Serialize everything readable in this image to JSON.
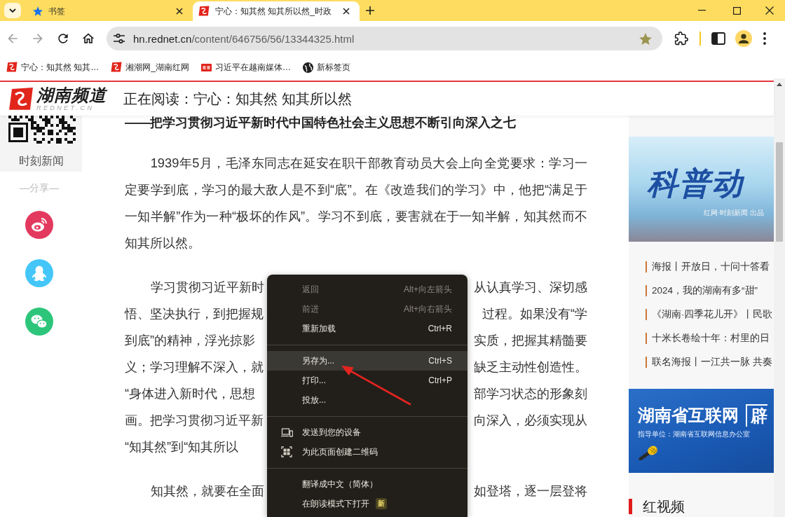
{
  "tab_strip": {
    "tabs": [
      {
        "kind": "bookmarks",
        "title": "书签",
        "selected": false
      },
      {
        "kind": "site",
        "title": "宁心：知其然 知其所以然_时政",
        "selected": true
      }
    ]
  },
  "toolbar": {
    "nav_buttons": [
      {
        "kind": "back",
        "disabled": true
      },
      {
        "kind": "forward",
        "disabled": true
      },
      {
        "kind": "reload",
        "disabled": false
      },
      {
        "kind": "home",
        "disabled": false
      }
    ],
    "url_host": "hn.rednet.cn",
    "url_path": "/content/646756/56/13344325.html",
    "bookmarked": true
  },
  "bookmarks_bar": [
    {
      "kind": "site",
      "label": "宁心：知其然 知其…"
    },
    {
      "kind": "site",
      "label": "湘潮网_湖南红网"
    },
    {
      "kind": "news",
      "label": "习近平在越南媒体…"
    },
    {
      "kind": "globe",
      "label": "新标签页"
    }
  ],
  "header": {
    "logo_title": "湖南频道",
    "logo_subtitle": "REDNET.CN",
    "reading": "正在阅读：宁心：知其然 知其所以然"
  },
  "left_rail": {
    "qr_caption": "时刻新闻",
    "share_label": "—分享—",
    "share": [
      {
        "kind": "weibo",
        "color": "#e4395e"
      },
      {
        "kind": "qq",
        "color": "#44c6f8"
      },
      {
        "kind": "wechat",
        "color": "#2dc57a"
      }
    ]
  },
  "article": {
    "subtitle": "——把学习贯彻习近平新时代中国特色社会主义思想不断引向深入之七",
    "paragraphs": [
      {
        "kind": "full",
        "text": "1939年5月，毛泽东同志在延安在职干部教育动员大会上向全党要求：学习一定要学到底，学习的最大敌人是不到“底”。在《改造我们的学习》中，他把“满足于一知半解”作为一种“极坏的作风”。学习不到底，要害就在于一知半解，知其然而不知其所以然。"
      },
      {
        "kind": "covered",
        "lines": [
          {
            "left": "学习贯彻习近平新时",
            "right": "从认真学习、深切感"
          },
          {
            "left": "悟、坚决执行，到把握规",
            "right": "过程。如果没有“学"
          },
          {
            "left": "到底”的精神，浮光掠影",
            "right": "实质，把握其精髓要"
          },
          {
            "left": "义；学习理解不深入，就",
            "right": "缺乏主动性创造性。"
          },
          {
            "left": "“身体进入新时代，思想",
            "right": "部学习状态的形象刻"
          },
          {
            "left": "画。把学习贯彻习近平新",
            "right": "向深入，必须实现从"
          },
          {
            "left": "“知其然”到“知其所以"
          }
        ]
      },
      {
        "kind": "covered",
        "lines": [
          {
            "left": "知其然，就要在全面",
            "right": "如登塔，逐一层登将"
          }
        ]
      }
    ]
  },
  "sidebar": {
    "banner_top": {
      "title": "科普动",
      "credit": "红网·时刻新闻 出品"
    },
    "links": [
      "海报丨开放日，十问十答看",
      "2024，我的湖南有多“甜”",
      "《湖南·四季花儿开》丨民歌",
      "十米长卷绘十年：村里的日",
      "联名海报丨一江共一脉 共奏"
    ],
    "banner_bottom": {
      "title": "湖南省互联网",
      "tag": "辟",
      "credit": "指导单位：湖南省互联网信息办公室"
    },
    "section_title": "红视频"
  },
  "context_menu": {
    "items": [
      {
        "kind": "item",
        "label": "返回",
        "shortcut": "Alt+向左箭头",
        "disabled": true,
        "selected": false
      },
      {
        "kind": "item",
        "label": "前进",
        "shortcut": "Alt+向右箭头",
        "disabled": true,
        "selected": false
      },
      {
        "kind": "item",
        "label": "重新加载",
        "shortcut": "Ctrl+R",
        "disabled": false,
        "selected": false
      },
      {
        "kind": "separator"
      },
      {
        "kind": "item",
        "label": "另存为...",
        "shortcut": "Ctrl+S",
        "disabled": false,
        "selected": true
      },
      {
        "kind": "item",
        "label": "打印...",
        "shortcut": "Ctrl+P",
        "disabled": false,
        "selected": false
      },
      {
        "kind": "item",
        "label": "投放...",
        "disabled": false,
        "selected": false
      },
      {
        "kind": "separator"
      },
      {
        "kind": "send",
        "label": "发送到您的设备",
        "disabled": false,
        "selected": false
      },
      {
        "kind": "qr",
        "label": "为此页面创建二维码",
        "disabled": false,
        "selected": false
      },
      {
        "kind": "separator"
      },
      {
        "kind": "item",
        "label": "翻译成中文（简体）",
        "disabled": false,
        "selected": false
      },
      {
        "kind": "item",
        "label": "在朗读模式下打开",
        "badge": "新",
        "disabled": false,
        "selected": false
      }
    ]
  }
}
